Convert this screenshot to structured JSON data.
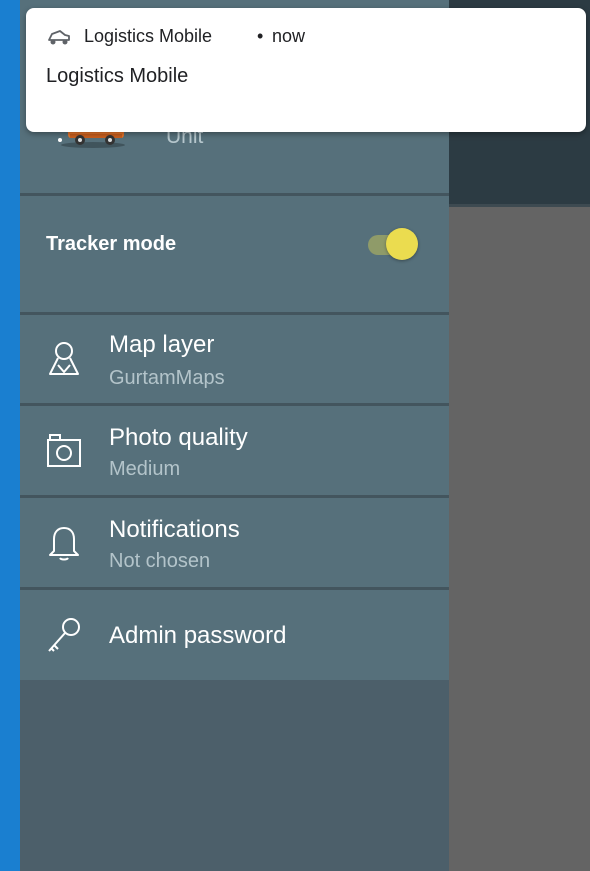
{
  "notification": {
    "app_name": "Logistics Mobile",
    "separator": "•",
    "time": "now",
    "title": "Logistics Mobile",
    "icon": "car-icon"
  },
  "drawer": {
    "unit_label": "Unit",
    "tracker_mode": {
      "label": "Tracker mode",
      "enabled": true
    },
    "menu": [
      {
        "title": "Map layer",
        "subtitle": "GurtamMaps",
        "icon": "map-pin-icon"
      },
      {
        "title": "Photo quality",
        "subtitle": "Medium",
        "icon": "photo-icon"
      },
      {
        "title": "Notifications",
        "subtitle": "Not chosen",
        "icon": "bell-icon"
      },
      {
        "title": "Admin password",
        "icon": "key-icon"
      }
    ]
  },
  "colors": {
    "background_blue": "#1a7fd0",
    "drawer": "#4c5f6a",
    "drawer_item": "#56707b",
    "toggle_thumb": "#ebdc4f",
    "scrim": "#646464"
  }
}
